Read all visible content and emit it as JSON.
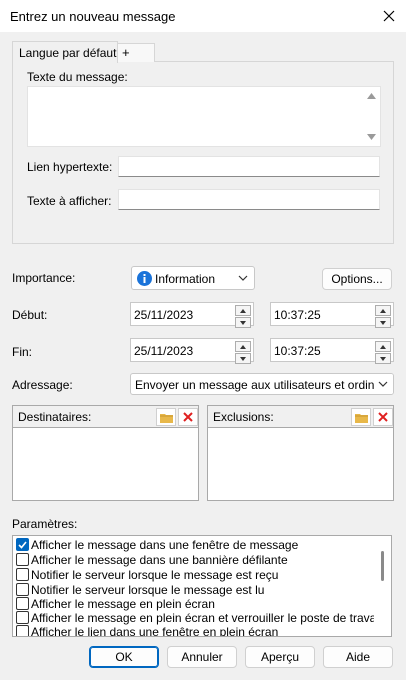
{
  "window": {
    "title": "Entrez un nouveau message"
  },
  "tabs": {
    "default": "Langue par défaut",
    "add": "+"
  },
  "message": {
    "text_label": "Texte du message:",
    "link_label": "Lien hypertexte:",
    "display_label": "Texte à afficher:"
  },
  "importance": {
    "label": "Importance:",
    "value": "Information",
    "options_button": "Options..."
  },
  "start": {
    "label": "Début:",
    "date": "25/11/2023",
    "time": "10:37:25"
  },
  "end": {
    "label": "Fin:",
    "date": "25/11/2023",
    "time": "10:37:25"
  },
  "addressing": {
    "label": "Adressage:",
    "value": "Envoyer un message aux utilisateurs et ordinateur"
  },
  "recipients": {
    "label": "Destinataires:"
  },
  "exclusions": {
    "label": "Exclusions:"
  },
  "params": {
    "label": "Paramètres:",
    "items": [
      {
        "label": "Afficher le message dans une fenêtre de message",
        "checked": true
      },
      {
        "label": "Afficher le message dans une bannière défilante",
        "checked": false
      },
      {
        "label": "Notifier le serveur lorsque le message est reçu",
        "checked": false
      },
      {
        "label": "Notifier le serveur lorsque le message est lu",
        "checked": false
      },
      {
        "label": "Afficher le message en plein écran",
        "checked": false
      },
      {
        "label": "Afficher le message en plein écran et verrouiller le poste de travail",
        "checked": false
      },
      {
        "label": "Afficher le lien dans une fenêtre en plein écran",
        "checked": false
      }
    ]
  },
  "buttons": {
    "ok": "OK",
    "cancel": "Annuler",
    "preview": "Aperçu",
    "help": "Aide"
  },
  "colors": {
    "accent": "#0067c0",
    "info_icon": "#1a73d9",
    "delete_icon": "#e02020",
    "folder_icon": "#e8b84a"
  }
}
